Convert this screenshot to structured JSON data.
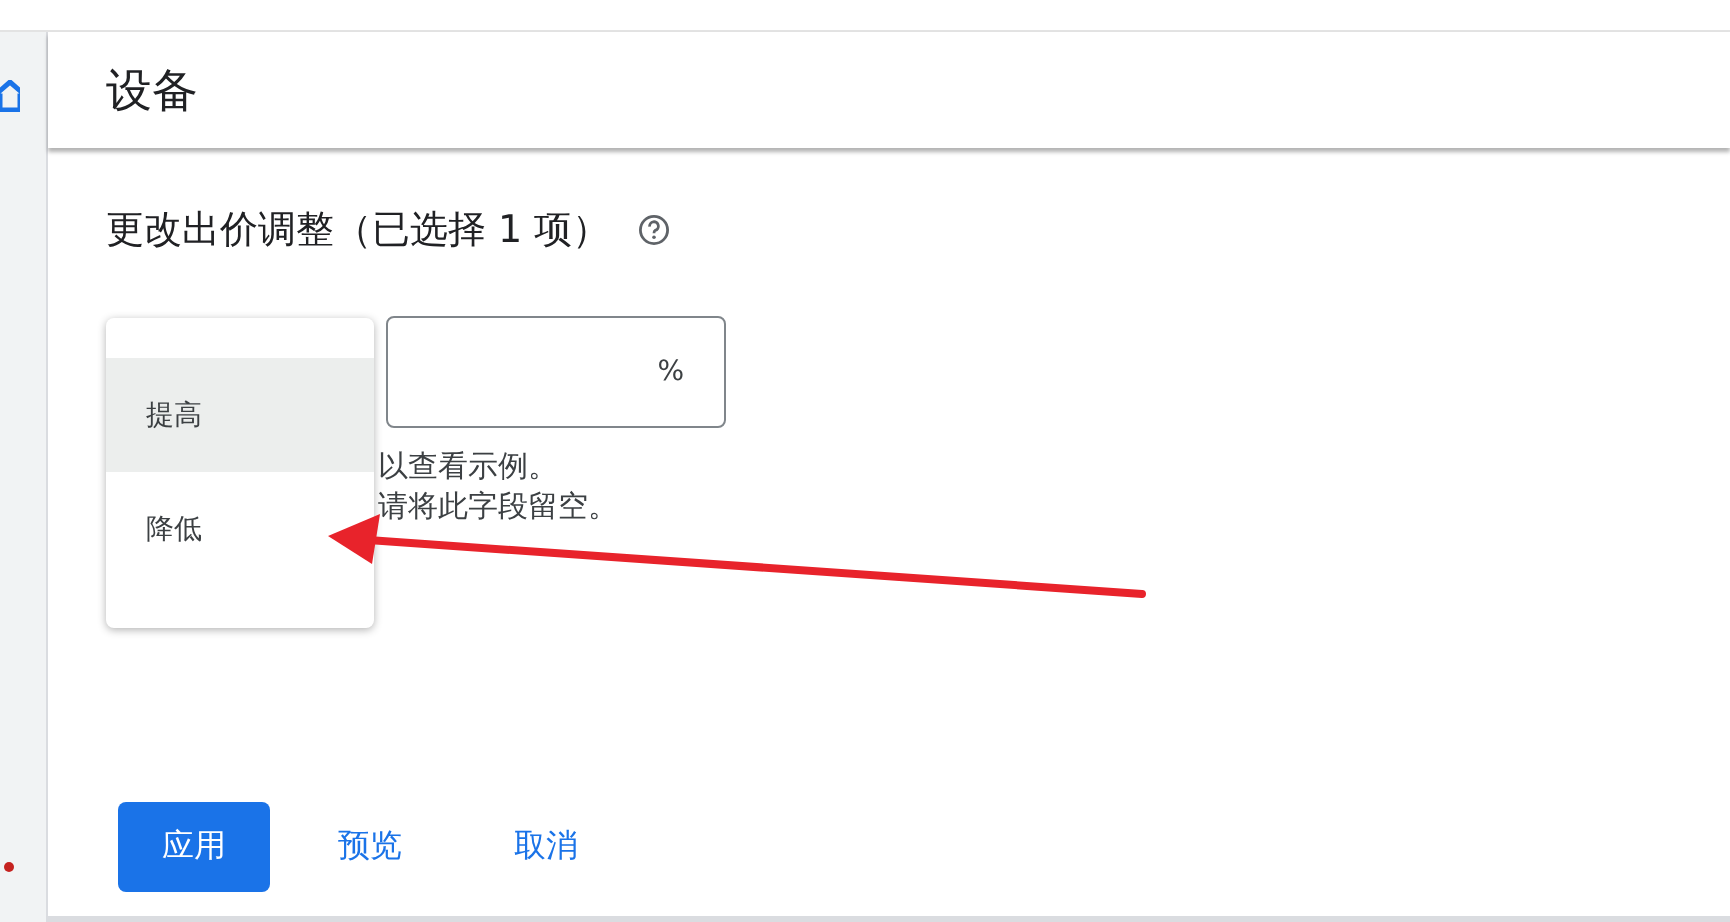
{
  "header": {
    "title": "设备"
  },
  "section": {
    "title": "更改出价调整（已选择 1 项）"
  },
  "menu": {
    "items": [
      {
        "label": "提高",
        "selected": true
      },
      {
        "label": "降低",
        "selected": false
      }
    ]
  },
  "input": {
    "suffix": "%"
  },
  "helper": [
    "以查看示例。",
    "请将此字段留空。"
  ],
  "buttons": [
    {
      "label": "应用",
      "kind": "primary"
    },
    {
      "label": "预览",
      "kind": "text"
    },
    {
      "label": "取消",
      "kind": "text"
    }
  ]
}
